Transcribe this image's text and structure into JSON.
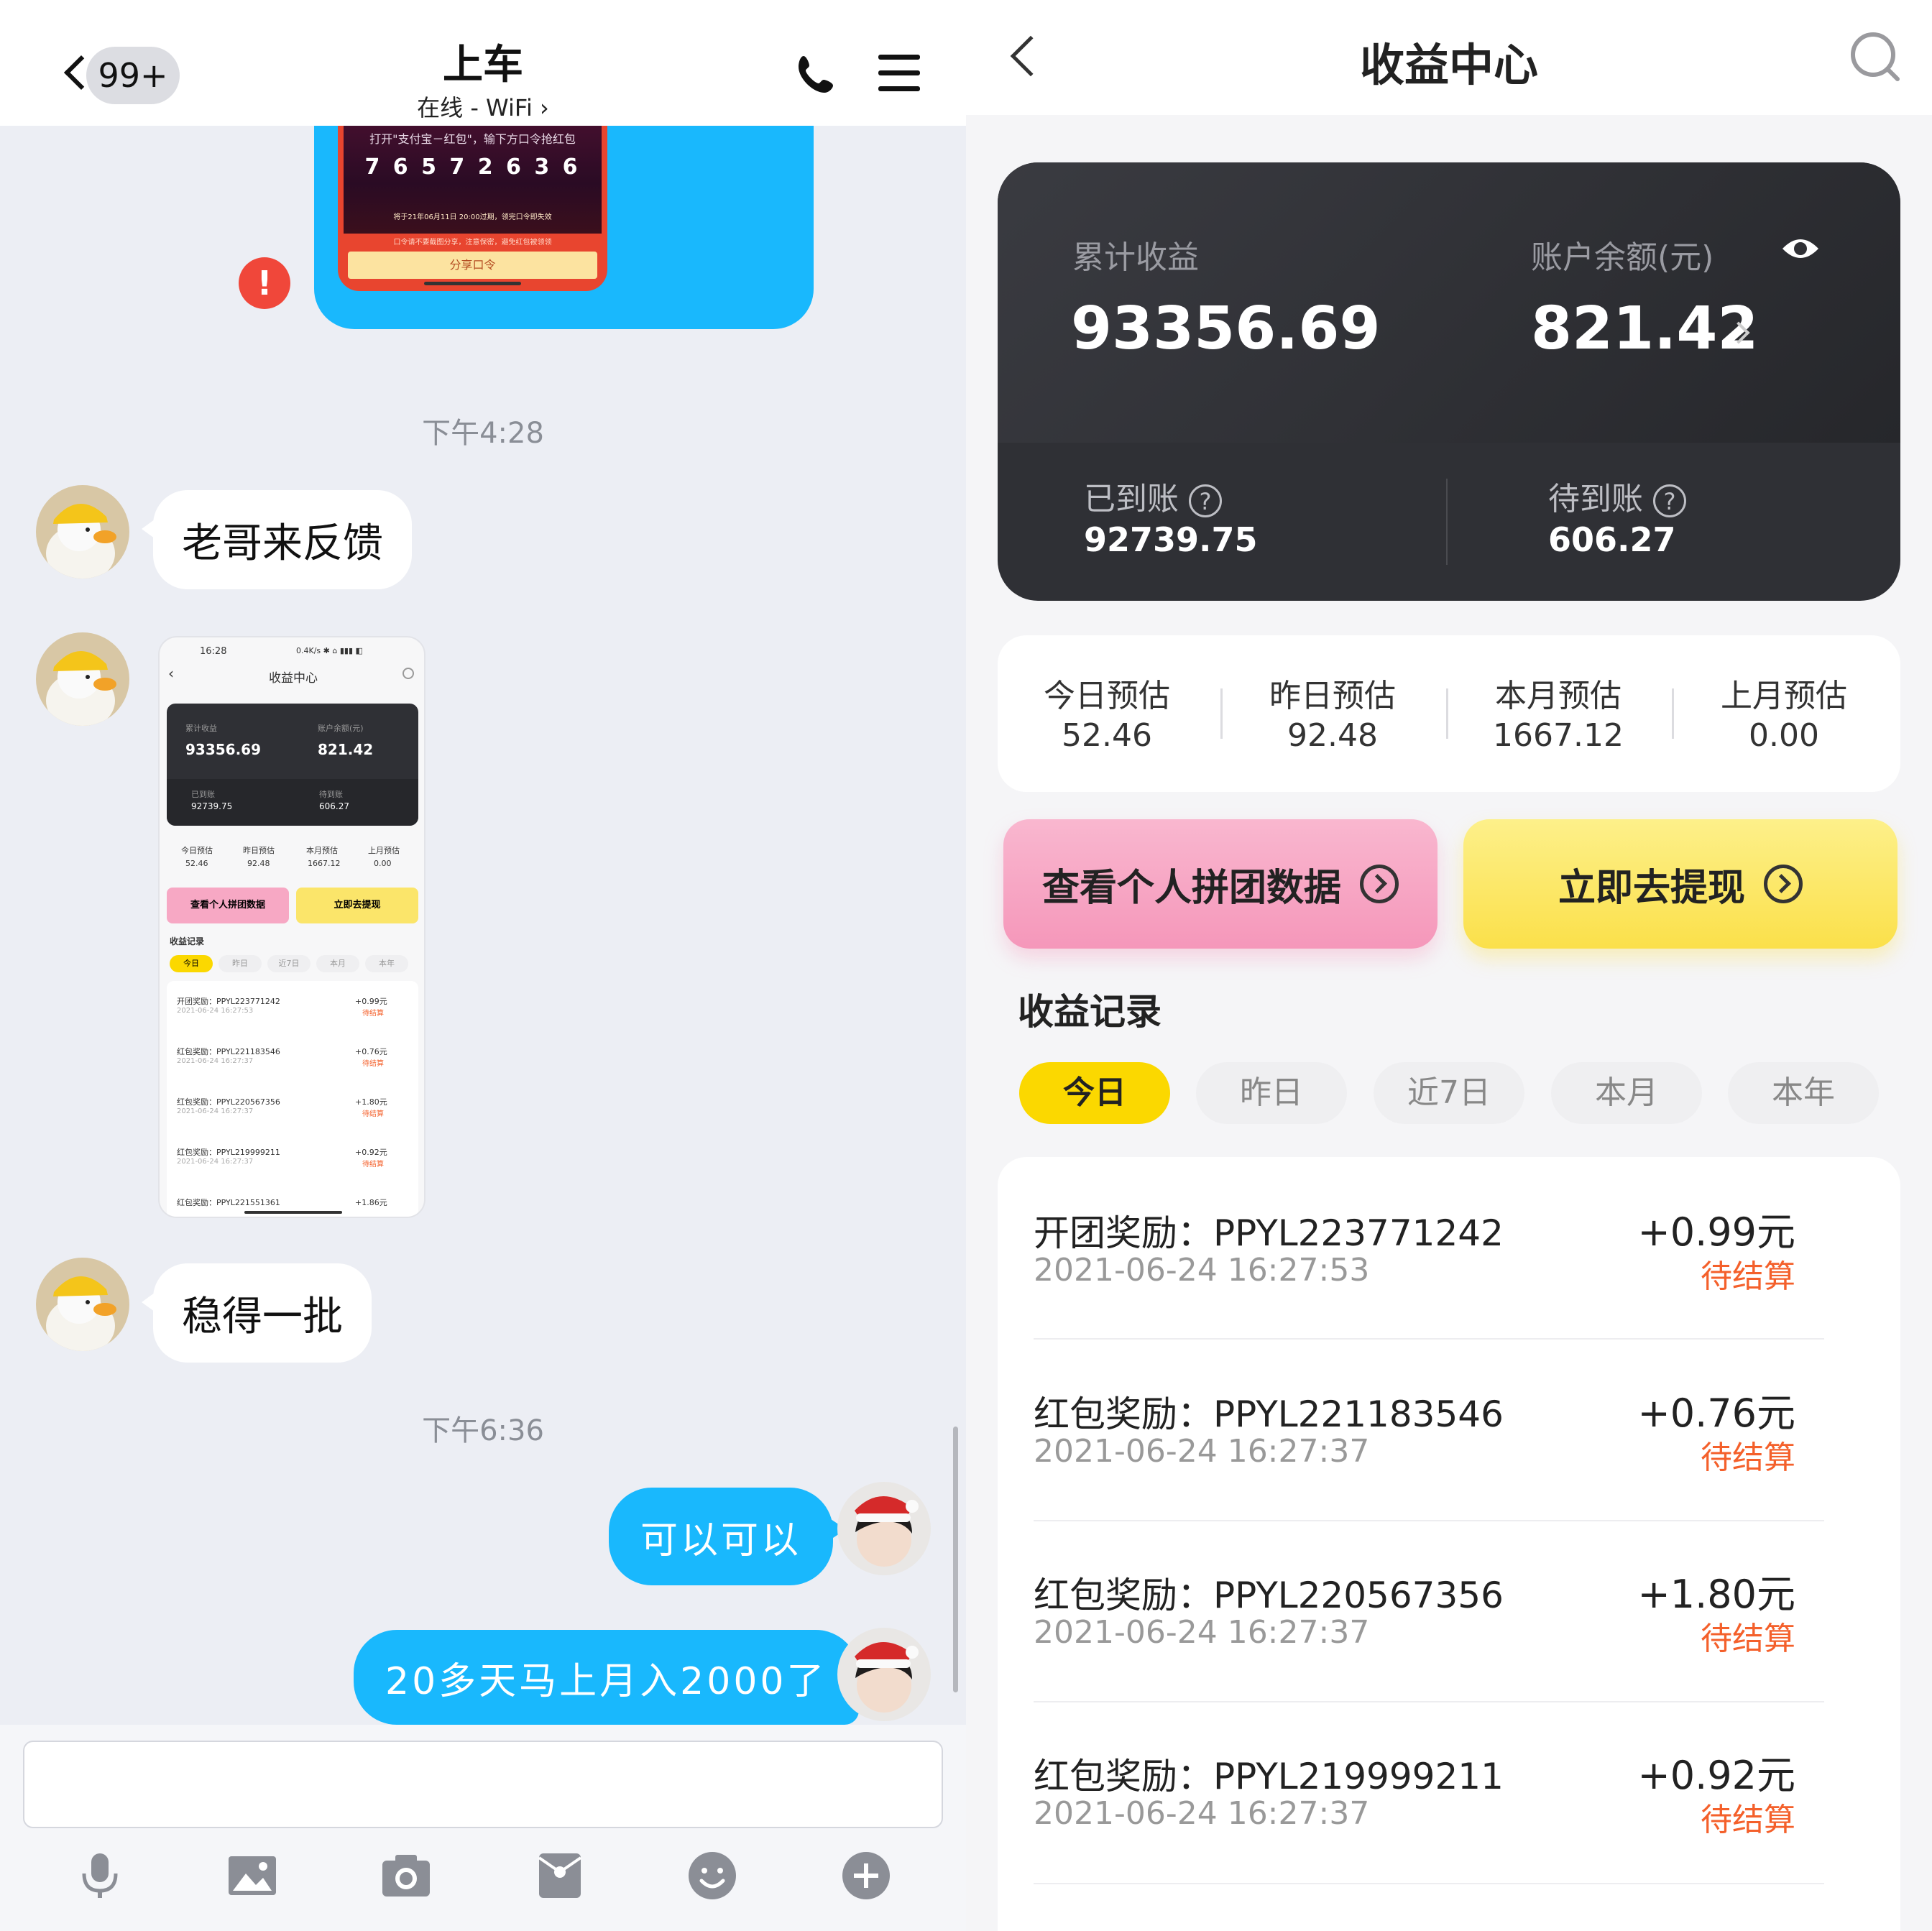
{
  "chat": {
    "unread_badge": "99+",
    "contact_name": "上车",
    "status": "在线 - WiFi",
    "image_message": {
      "line1": "打开\"支付宝－红包\"，输下方口令抢红包",
      "code": "7 6 5 7 2 6 3 6",
      "expire": "将于21年06月11日 20:00过期，领完口令即失效",
      "warn": "口令请不要截图分享，注意保密，避免红包被领领",
      "share_btn": "分享口令"
    },
    "error_mark": "!",
    "time1": "下午4:28",
    "msg1": "老哥来反馈",
    "msg2": "稳得一批",
    "time2": "下午6:36",
    "msg3": "可以可以",
    "msg4": "20多天马上月入2000了",
    "thumb": {
      "status_time": "16:28",
      "status_right": "0.4K/s ✱ ⌂ ▮▮▮ ◧",
      "title": "收益中心",
      "cum_label": "累计收益",
      "bal_label": "账户余额(元)",
      "cum": "93356.69",
      "bal": "821.42",
      "arrived_label": "已到账",
      "pending_label": "待到账",
      "arrived": "92739.75",
      "pending": "606.27",
      "est_labels": [
        "今日预估",
        "昨日预估",
        "本月预估",
        "上月预估"
      ],
      "est_values": [
        "52.46",
        "92.48",
        "1667.12",
        "0.00"
      ],
      "btn1": "查看个人拼团数据",
      "btn2": "立即去提现",
      "records_title": "收益记录",
      "tabs": [
        "今日",
        "昨日",
        "近7日",
        "本月",
        "本年"
      ],
      "rows": [
        {
          "t": "开团奖励：PPYL223771242",
          "d": "2021-06-24 16:27:53",
          "a": "+0.99元",
          "s": "待结算"
        },
        {
          "t": "红包奖励：PPYL221183546",
          "d": "2021-06-24 16:27:37",
          "a": "+0.76元",
          "s": "待结算"
        },
        {
          "t": "红包奖励：PPYL220567356",
          "d": "2021-06-24 16:27:37",
          "a": "+1.80元",
          "s": "待结算"
        },
        {
          "t": "红包奖励：PPYL219999211",
          "d": "2021-06-24 16:27:37",
          "a": "+0.92元",
          "s": "待结算"
        },
        {
          "t": "红包奖励：PPYL221551361",
          "d": "",
          "a": "+1.86元",
          "s": ""
        }
      ]
    }
  },
  "income": {
    "title": "收益中心",
    "cumulative_label": "累计收益",
    "cumulative_value": "93356.69",
    "balance_label": "账户余额(元)",
    "balance_value": "821.42",
    "arrived_label": "已到账",
    "arrived_value": "92739.75",
    "pending_label": "待到账",
    "pending_value": "606.27",
    "estimates": [
      {
        "label": "今日预估",
        "value": "52.46"
      },
      {
        "label": "昨日预估",
        "value": "92.48"
      },
      {
        "label": "本月预估",
        "value": "1667.12"
      },
      {
        "label": "上月预估",
        "value": "0.00"
      }
    ],
    "btn_group_data": "查看个人拼团数据",
    "btn_withdraw": "立即去提现",
    "records_title": "收益记录",
    "tabs": [
      "今日",
      "昨日",
      "近7日",
      "本月",
      "本年"
    ],
    "records": [
      {
        "title": "开团奖励：PPYL223771242",
        "time": "2021-06-24 16:27:53",
        "amount": "+0.99元",
        "state": "待结算"
      },
      {
        "title": "红包奖励：PPYL221183546",
        "time": "2021-06-24 16:27:37",
        "amount": "+0.76元",
        "state": "待结算"
      },
      {
        "title": "红包奖励：PPYL220567356",
        "time": "2021-06-24 16:27:37",
        "amount": "+1.80元",
        "state": "待结算"
      },
      {
        "title": "红包奖励：PPYL219999211",
        "time": "2021-06-24 16:27:37",
        "amount": "+0.92元",
        "state": "待结算"
      }
    ]
  },
  "colors": {
    "chat_blue": "#19b8fd",
    "accent_yellow": "#fbd800",
    "pending_orange": "#f4602b",
    "pink_btn": "#f7a8c4"
  }
}
